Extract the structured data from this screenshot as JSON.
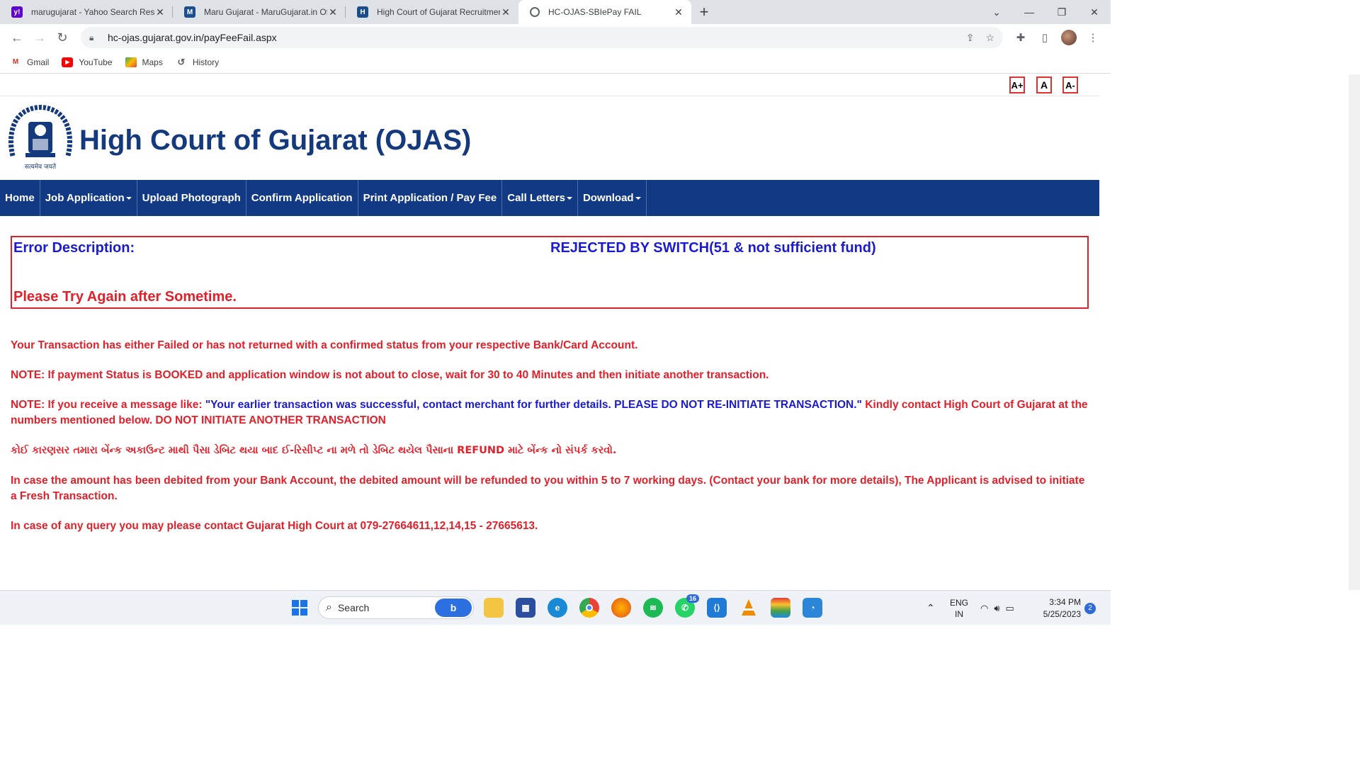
{
  "browser": {
    "tabs": [
      {
        "title": "marugujarat - Yahoo Search Resu",
        "fav": "Y!",
        "favcolor": "#5f01d1"
      },
      {
        "title": "Maru Gujarat - MaruGujarat.in Of",
        "fav": "M",
        "favcolor": "#1b4e8e"
      },
      {
        "title": "High Court of Gujarat Recruitmen",
        "fav": "H",
        "favcolor": "#1b4e8e"
      },
      {
        "title": "HC-OJAS-SBIePay FAIL",
        "fav": "",
        "favcolor": "#ffffff"
      }
    ],
    "url": "hc-ojas.gujarat.gov.in/payFeeFail.aspx",
    "bookmarks": [
      "Gmail",
      "YouTube",
      "Maps",
      "History"
    ]
  },
  "page": {
    "font_buttons": [
      "A+",
      "A",
      "A-"
    ],
    "site_title": "High Court of Gujarat (OJAS)",
    "emblem_caption": "सत्यमेव जयते",
    "nav": [
      {
        "label": "Home",
        "dropdown": false
      },
      {
        "label": "Job Application",
        "dropdown": true
      },
      {
        "label": "Upload Photograph",
        "dropdown": false
      },
      {
        "label": "Confirm Application",
        "dropdown": false
      },
      {
        "label": "Print Application / Pay Fee",
        "dropdown": false
      },
      {
        "label": "Call Letters",
        "dropdown": true
      },
      {
        "label": "Download",
        "dropdown": true
      }
    ],
    "error": {
      "label": "Error Description:",
      "value": "REJECTED BY SWITCH(51 & not sufficient fund)",
      "retry": "Please Try Again after Sometime."
    },
    "messages": {
      "m1": "Your Transaction has either Failed or has not returned with a confirmed status from your respective Bank/Card Account.",
      "m2": "NOTE: If payment Status is BOOKED and application window is not about to close, wait for 30 to 40 Minutes and then initiate another transaction.",
      "m3_a": "NOTE: If you receive a message like: ",
      "m3_b": "\"Your earlier transaction was successful, contact merchant for further details. PLEASE DO NOT RE-INITIATE TRANSACTION.\"",
      "m3_c": " Kindly contact High Court of Gujarat at the numbers mentioned below. DO NOT INITIATE ANOTHER TRANSACTION",
      "m4": "કોઈ કારણસર તમારા બેંન્ક અકાઉન્ટ માથી પૈસા ડેબિટ થયા બાદ ઈ-રિસીપ્ટ ના મળે તો ડેબિટ થયેલ પૈસાના REFUND માટે બેંન્ક નો સંપર્ક કરવો.",
      "m5": "In case the amount has been debited from your Bank Account, the debited amount will be refunded to you within 5 to 7 working days. (Contact your bank for more details), The Applicant is advised to initiate a Fresh Transaction.",
      "m6": "In case of any query you may please contact Gujarat High Court at 079-27664611,12,14,15 - 27665613."
    }
  },
  "taskbar": {
    "search_placeholder": "Search",
    "whatsapp_badge": "16",
    "lang_top": "ENG",
    "lang_bottom": "IN",
    "time": "3:34 PM",
    "date": "5/25/2023",
    "notif_count": "2"
  }
}
